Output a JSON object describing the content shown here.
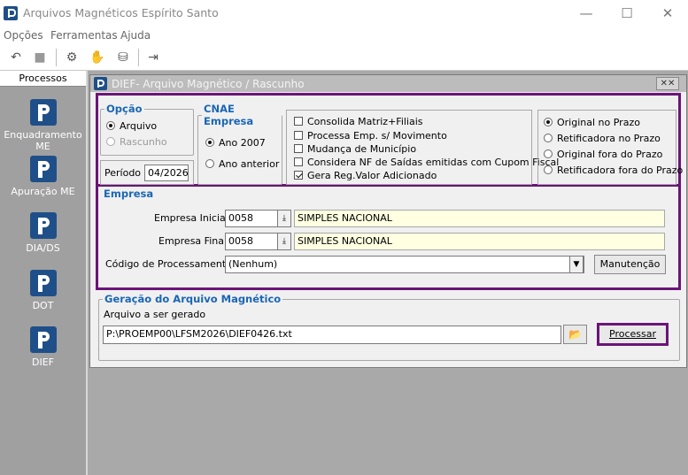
{
  "window": {
    "title": "Arquivos Magnéticos Espírito Santo",
    "minimize": "—",
    "maximize": "☐",
    "close": "✕"
  },
  "menu": [
    "Opções",
    "Ferramentas",
    "Ajuda"
  ],
  "toolbar": {
    "undo": "↶",
    "stop": "■",
    "tool1": "⚙",
    "tool2": "✋",
    "tool3": "⛁",
    "exit": "⇥"
  },
  "sidebar": {
    "header": "Processos",
    "items": [
      "Enquadramento ME",
      "Apuração ME",
      "DIA/DS",
      "DOT",
      "DIEF"
    ]
  },
  "dialog": {
    "title": "DIEF- Arquivo Magnético / Rascunho",
    "close": "✕✕",
    "opcao": {
      "legend": "Opção",
      "arquivo": "Arquivo",
      "rascunho": "Rascunho"
    },
    "periodo": {
      "label": "Período",
      "value": "04/2026"
    },
    "cnae": {
      "legend": "CNAE Empresa",
      "ano2007": "Ano 2007",
      "anterior": "Ano anterior"
    },
    "checks": [
      {
        "label": "Consolida Matriz+Filiais",
        "checked": false
      },
      {
        "label": "Processa Emp. s/ Movimento",
        "checked": false
      },
      {
        "label": "Mudança de Município",
        "checked": false
      },
      {
        "label": "Considera NF de Saídas emitidas com Cupom Fiscal",
        "checked": false
      },
      {
        "label": "Gera Reg.Valor Adicionado",
        "checked": true
      }
    ],
    "prazo": [
      {
        "label": "Original no Prazo",
        "selected": true
      },
      {
        "label": "Retificadora no Prazo",
        "selected": false
      },
      {
        "label": "Original fora do Prazo",
        "selected": false
      },
      {
        "label": "Retificadora fora do Prazo",
        "selected": false
      }
    ],
    "empresa": {
      "legend": "Empresa",
      "inicial_label": "Empresa Inicial",
      "inicial_code": "0058",
      "inicial_name": "SIMPLES NACIONAL",
      "final_label": "Empresa Final",
      "final_code": "0058",
      "final_name": "SIMPLES NACIONAL",
      "codigo_label": "Código de Processamento",
      "codigo_value": "(Nenhum)",
      "manutencao": "Manutenção",
      "dd_icon": "⤓",
      "combo_icon": "▼"
    },
    "geracao": {
      "legend": "Geração do Arquivo Magnético",
      "file_label": "Arquivo a ser gerado",
      "file_path": "P:\\PROEMP00\\LFSM2026\\DIEF0426.txt",
      "folder_icon": "📂",
      "processar": "Processar"
    }
  }
}
